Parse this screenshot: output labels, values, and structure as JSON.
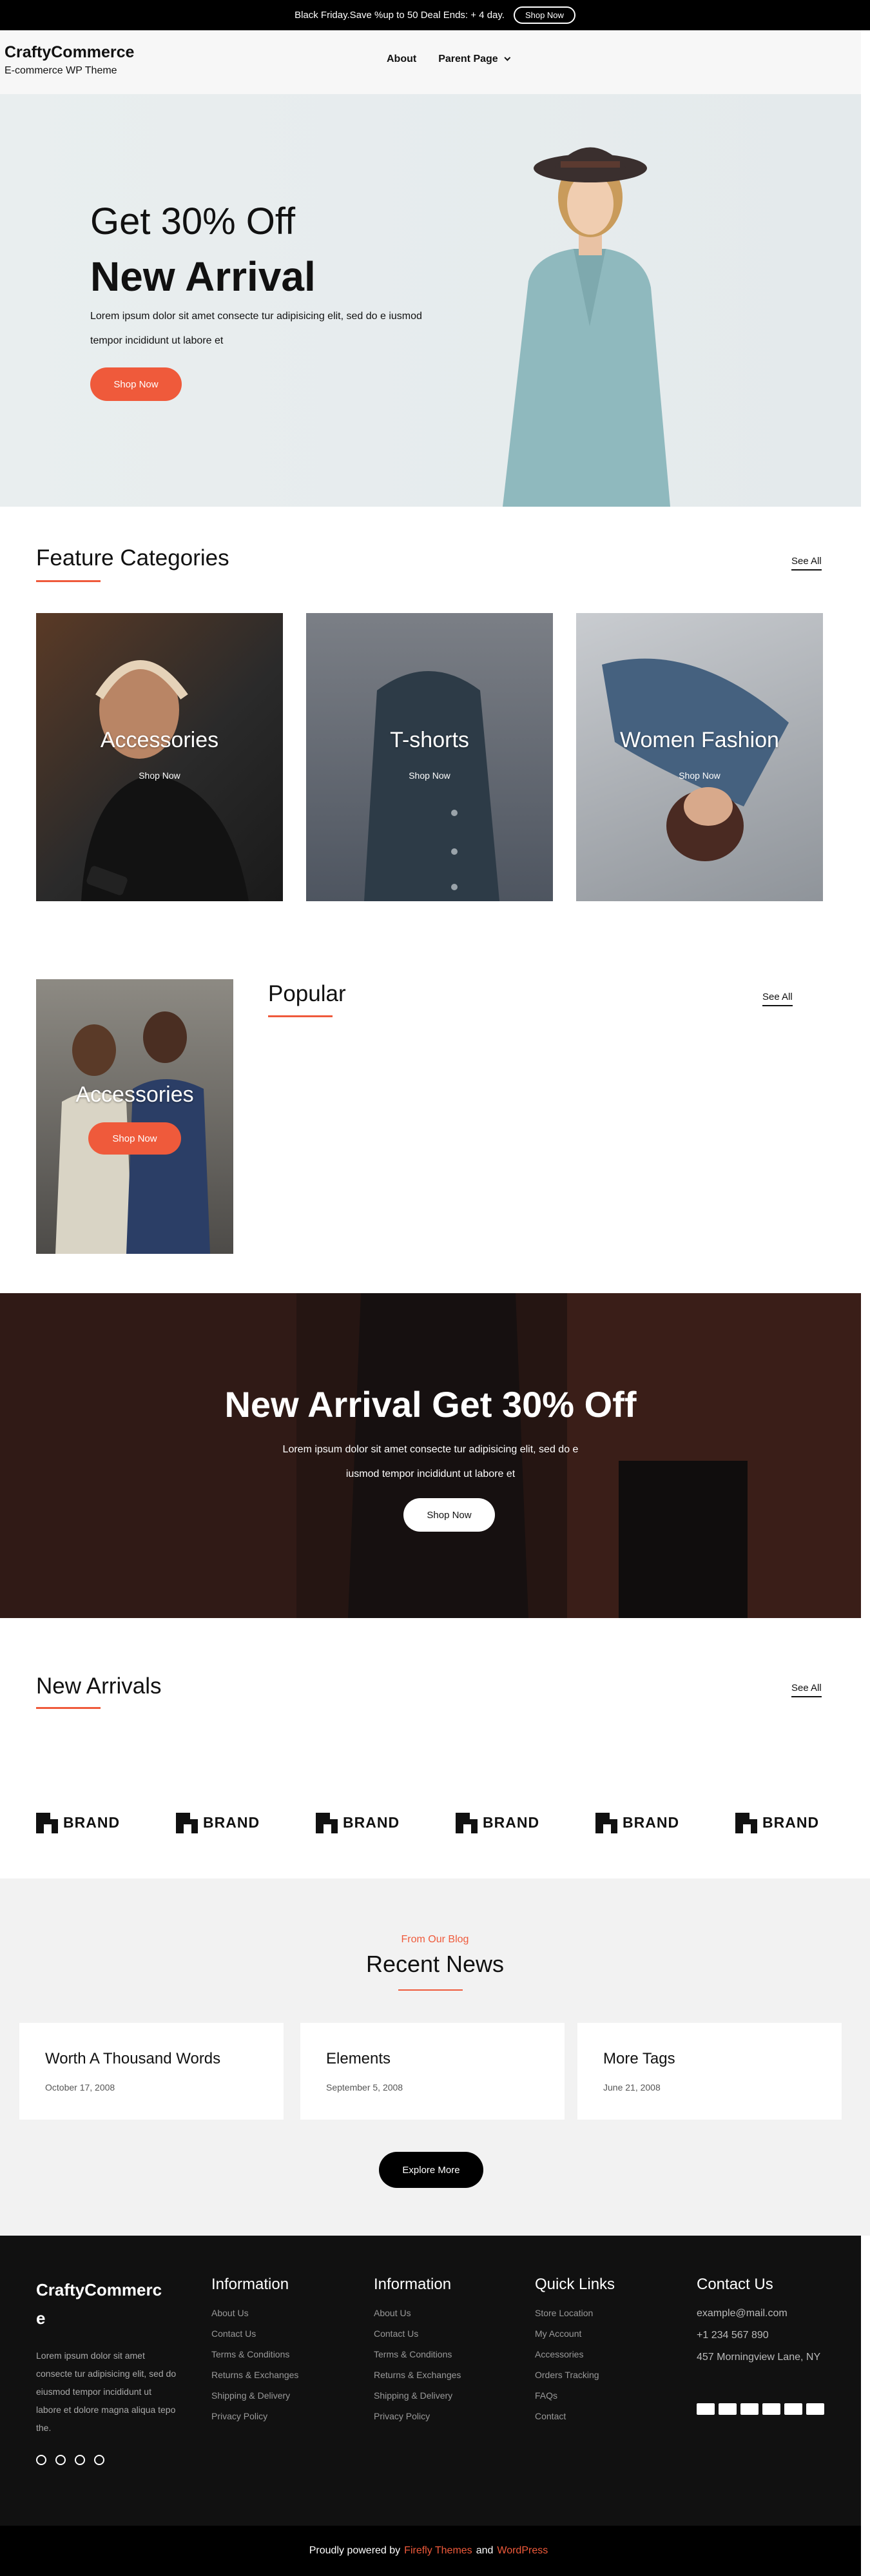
{
  "topbar": {
    "text": "Black Friday.Save %up to 50 Deal Ends: + 4 day.",
    "button": "Shop Now"
  },
  "header": {
    "title": "CraftyCommerce",
    "subtitle": "E-commerce WP Theme",
    "nav": [
      "About",
      "Parent Page"
    ]
  },
  "hero": {
    "line1": "Get 30% Off",
    "line2": "New Arrival",
    "text": "Lorem ipsum dolor sit amet consecte tur adipisicing elit, sed do e iusmod tempor incididunt ut labore et",
    "button": "Shop Now"
  },
  "features": {
    "title": "Feature Categories",
    "see_all": "See All",
    "cards": [
      {
        "label": "Accessories",
        "shop": "Shop Now"
      },
      {
        "label": "T-shorts",
        "shop": "Shop Now"
      },
      {
        "label": "Women Fashion",
        "shop": "Shop Now"
      }
    ]
  },
  "popular": {
    "title": "Popular",
    "see_all": "See All",
    "card_label": "Accessories",
    "card_button": "Shop Now"
  },
  "banner": {
    "title": "New Arrival Get 30% Off",
    "text": "Lorem ipsum dolor sit amet consecte tur adipisicing elit, sed do e iusmod tempor incididunt ut labore et",
    "button": "Shop Now"
  },
  "arrivals": {
    "title": "New Arrivals",
    "see_all": "See All",
    "brand_word": "BRAND"
  },
  "blog": {
    "kicker": "From Our Blog",
    "title": "Recent News",
    "posts": [
      {
        "title": "Worth A Thousand Words",
        "date": "October 17, 2008"
      },
      {
        "title": "Elements",
        "date": "September 5, 2008"
      },
      {
        "title": "More Tags",
        "date": "June 21, 2008"
      }
    ],
    "button": "Explore More"
  },
  "footer": {
    "brand": "CraftyCommerc e",
    "text": "Lorem ipsum dolor sit amet consecte tur adipisicing elit, sed do eiusmod tempor incididunt ut labore et dolore magna aliqua tepo the.",
    "col1": {
      "title": "Information",
      "items": [
        "About Us",
        "Contact Us",
        "Terms & Conditions",
        "Returns & Exchanges",
        "Shipping & Delivery",
        "Privacy Policy"
      ]
    },
    "col2": {
      "title": "Information",
      "items": [
        "About Us",
        "Contact Us",
        "Terms & Conditions",
        "Returns & Exchanges",
        "Shipping & Delivery",
        "Privacy Policy"
      ]
    },
    "col3": {
      "title": "Quick Links",
      "items": [
        "Store Location",
        "My Account",
        "Accessories",
        "Orders Tracking",
        "FAQs",
        "Contact"
      ]
    },
    "col4": {
      "title": "Contact Us",
      "items": [
        "example@mail.com",
        "+1 234 567 890",
        "457 Morningview Lane, NY"
      ]
    },
    "powered_prefix": "Proudly powered by",
    "powered_theme": "Firefly Themes",
    "powered_and": "and",
    "powered_wp": "WordPress"
  }
}
